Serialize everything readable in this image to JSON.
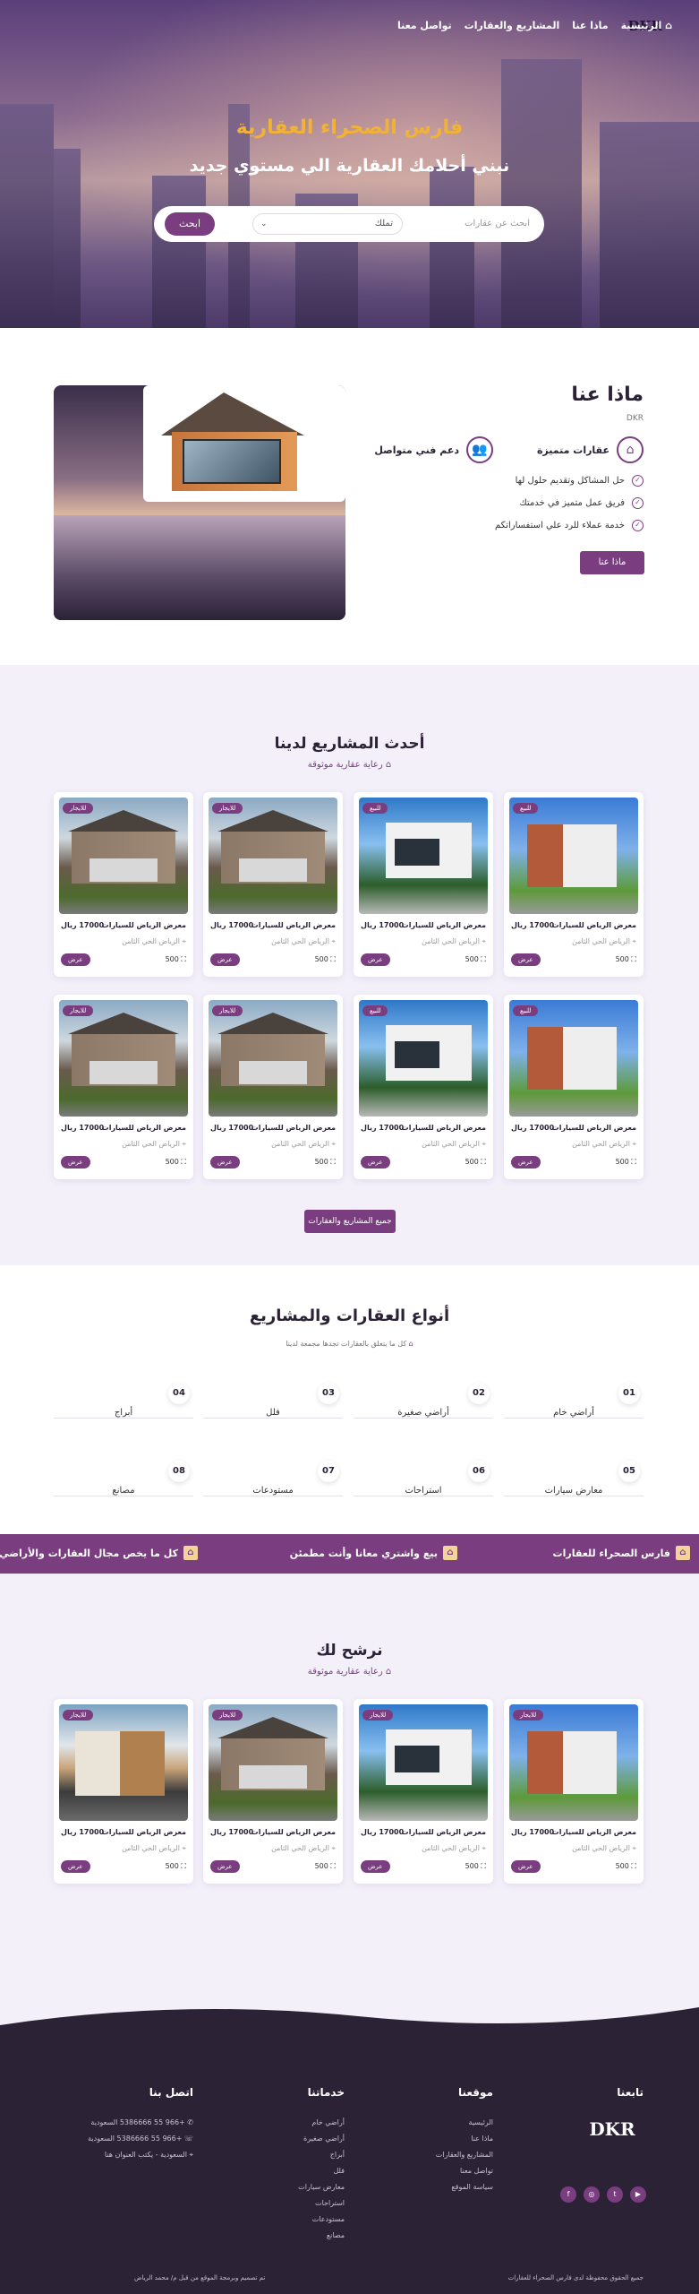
{
  "nav": {
    "items": [
      "الرئيسية",
      "ماذا عنا",
      "المشاريع والعقارات",
      "تواصل معنا"
    ],
    "logo": "DKR"
  },
  "hero": {
    "title": "فارس الصحراء العقارية",
    "subtitle": "نبني أحلامك العقارية الي مستوي جديد",
    "search_placeholder": "ابحث عن عقارات",
    "select_value": "تملك",
    "search_button": "ابحث"
  },
  "about": {
    "title": "ماذا عنا",
    "small": "DKR",
    "feature1": "عقارات متميزة",
    "feature2": "دعم فني متواصل",
    "checks": [
      "حل المشاكل وتقديم حلول لها",
      "فريق عمل متميز في خدمتك",
      "خدمة عملاء للرد علي استفساراتكم"
    ],
    "button": "ماذا عنا"
  },
  "projects": {
    "title": "أحدث المشاريع لدينا",
    "subtitle": "رعاية عقارية موثوقة",
    "all_button": "جميع المشاريع والعقارات",
    "cards": [
      {
        "badge": "للبيع",
        "name": "معرض الرياض للسيارات",
        "price": "17000 ريال",
        "loc": "الرياض الحي الثامن",
        "area": "500",
        "view": "عرض"
      },
      {
        "badge": "للبيع",
        "name": "معرض الرياض للسيارات",
        "price": "17000 ريال",
        "loc": "الرياض الحي الثامن",
        "area": "500",
        "view": "عرض"
      },
      {
        "badge": "للايجار",
        "name": "معرض الرياض للسيارات",
        "price": "17000 ريال",
        "loc": "الرياض الحي الثامن",
        "area": "500",
        "view": "عرض"
      },
      {
        "badge": "للايجار",
        "name": "معرض الرياض للسيارات",
        "price": "17000 ريال",
        "loc": "الرياض الحي الثامن",
        "area": "500",
        "view": "عرض"
      },
      {
        "badge": "للبيع",
        "name": "معرض الرياض للسيارات",
        "price": "17000 ريال",
        "loc": "الرياض الحي الثامن",
        "area": "500",
        "view": "عرض"
      },
      {
        "badge": "للبيع",
        "name": "معرض الرياض للسيارات",
        "price": "17000 ريال",
        "loc": "الرياض الحي الثامن",
        "area": "500",
        "view": "عرض"
      },
      {
        "badge": "للايجار",
        "name": "معرض الرياض للسيارات",
        "price": "17000 ريال",
        "loc": "الرياض الحي الثامن",
        "area": "500",
        "view": "عرض"
      },
      {
        "badge": "للايجار",
        "name": "معرض الرياض للسيارات",
        "price": "17000 ريال",
        "loc": "الرياض الحي الثامن",
        "area": "500",
        "view": "عرض"
      }
    ]
  },
  "types": {
    "title": "أنواع العقارات والمشاريع",
    "subtitle": "كل ما يتعلق بالعقارات تجدها مجمعة لدينا",
    "items": [
      {
        "num": "01",
        "label": "أراضي خام"
      },
      {
        "num": "02",
        "label": "أراضي صغيرة"
      },
      {
        "num": "03",
        "label": "فلل"
      },
      {
        "num": "04",
        "label": "أبراج"
      },
      {
        "num": "05",
        "label": "معارض سيارات"
      },
      {
        "num": "06",
        "label": "استراحات"
      },
      {
        "num": "07",
        "label": "مستودعات"
      },
      {
        "num": "08",
        "label": "مصانع"
      }
    ]
  },
  "banner": [
    "فارس الصحراء للعقارات",
    "بيع واشتري معانا وأنت مطمئن",
    "كل ما يخص مجال العقارات والأراضي"
  ],
  "recommend": {
    "title": "نرشح لك",
    "subtitle": "رعاية عقارية موثوقة",
    "cards": [
      {
        "badge": "للايجار",
        "name": "معرض الرياض للسيارات",
        "price": "17000 ريال",
        "loc": "الرياض الحي الثامن",
        "area": "500",
        "view": "عرض"
      },
      {
        "badge": "للايجار",
        "name": "معرض الرياض للسيارات",
        "price": "17000 ريال",
        "loc": "الرياض الحي الثامن",
        "area": "500",
        "view": "عرض"
      },
      {
        "badge": "للايجار",
        "name": "معرض الرياض للسيارات",
        "price": "17000 ريال",
        "loc": "الرياض الحي الثامن",
        "area": "500",
        "view": "عرض"
      },
      {
        "badge": "للايجار",
        "name": "معرض الرياض للسيارات",
        "price": "17000 ريال",
        "loc": "الرياض الحي الثامن",
        "area": "500",
        "view": "عرض"
      }
    ]
  },
  "footer": {
    "follow": "تابعنا",
    "logo": "DKR",
    "site_title": "موقعنا",
    "site_links": [
      "الرئيسية",
      "ماذا عنا",
      "المشاريع والعقارات",
      "تواصل معنا",
      "سياسة الموقع"
    ],
    "services_title": "خدماتنا",
    "services": [
      "أراضي خام",
      "أراضي صغيرة",
      "أبراج",
      "فلل",
      "معارض سيارات",
      "استراحات",
      "مستودعات",
      "مصانع"
    ],
    "contact_title": "اتصل بنا",
    "contacts": [
      "+966 55 5386666 السعودية",
      "+966 55 5386666 السعودية",
      "السعودية - يكتب العنوان هنا"
    ],
    "copyright": "جميع الحقوق محفوظة لدى فارس الصحراء للعقارات",
    "credit": "تم تصميم وبرمجة الموقع من قبل م/ محمد الرياض"
  },
  "colors": {
    "accent": "#7a3e80",
    "gold": "#f2b233",
    "dark": "#2b2236",
    "bg": "#f3f0fa"
  }
}
